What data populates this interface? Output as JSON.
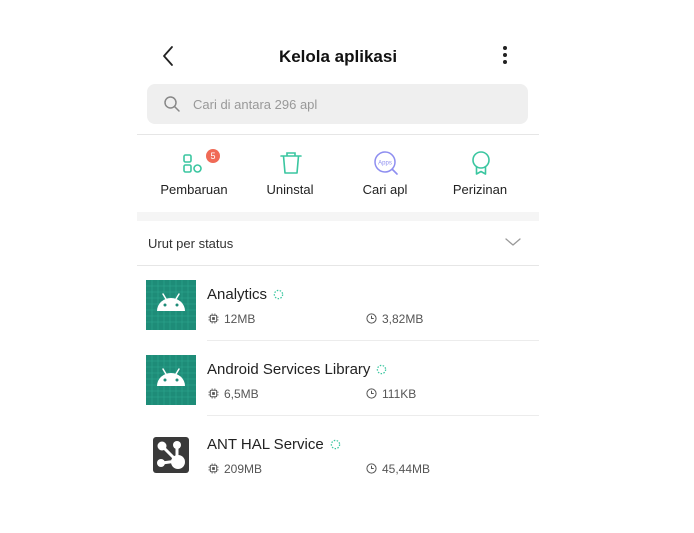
{
  "header": {
    "title": "Kelola aplikasi",
    "back_icon": "chevron-left-icon",
    "more_icon": "more-vertical-icon"
  },
  "search": {
    "placeholder": "Cari di antara 296 apl",
    "value": ""
  },
  "actions": [
    {
      "label": "Pembaruan",
      "icon": "updates-grid-icon",
      "badge": "5"
    },
    {
      "label": "Uninstal",
      "icon": "trash-icon"
    },
    {
      "label": "Cari apl",
      "icon": "apps-search-icon",
      "icon_text": "Apps"
    },
    {
      "label": "Perizinan",
      "icon": "permission-badge-icon"
    }
  ],
  "sort": {
    "label": "Urut per status",
    "icon": "chevron-down-icon"
  },
  "apps": [
    {
      "name": "Analytics",
      "storage": "12MB",
      "cache": "3,82MB",
      "icon": "android-app-icon"
    },
    {
      "name": "Android Services Library",
      "storage": "6,5MB",
      "cache": "111KB",
      "icon": "android-app-icon"
    },
    {
      "name": "ANT HAL Service",
      "storage": "209MB",
      "cache": "45,44MB",
      "icon": "ant-app-icon"
    }
  ],
  "colors": {
    "accent": "#3ac6a0",
    "badge": "#f06a56",
    "android_green": "#1e8c78",
    "ant_dark": "#3a3a3a",
    "search_bg": "#efefef",
    "apps_icon": "#8e8ef0"
  }
}
